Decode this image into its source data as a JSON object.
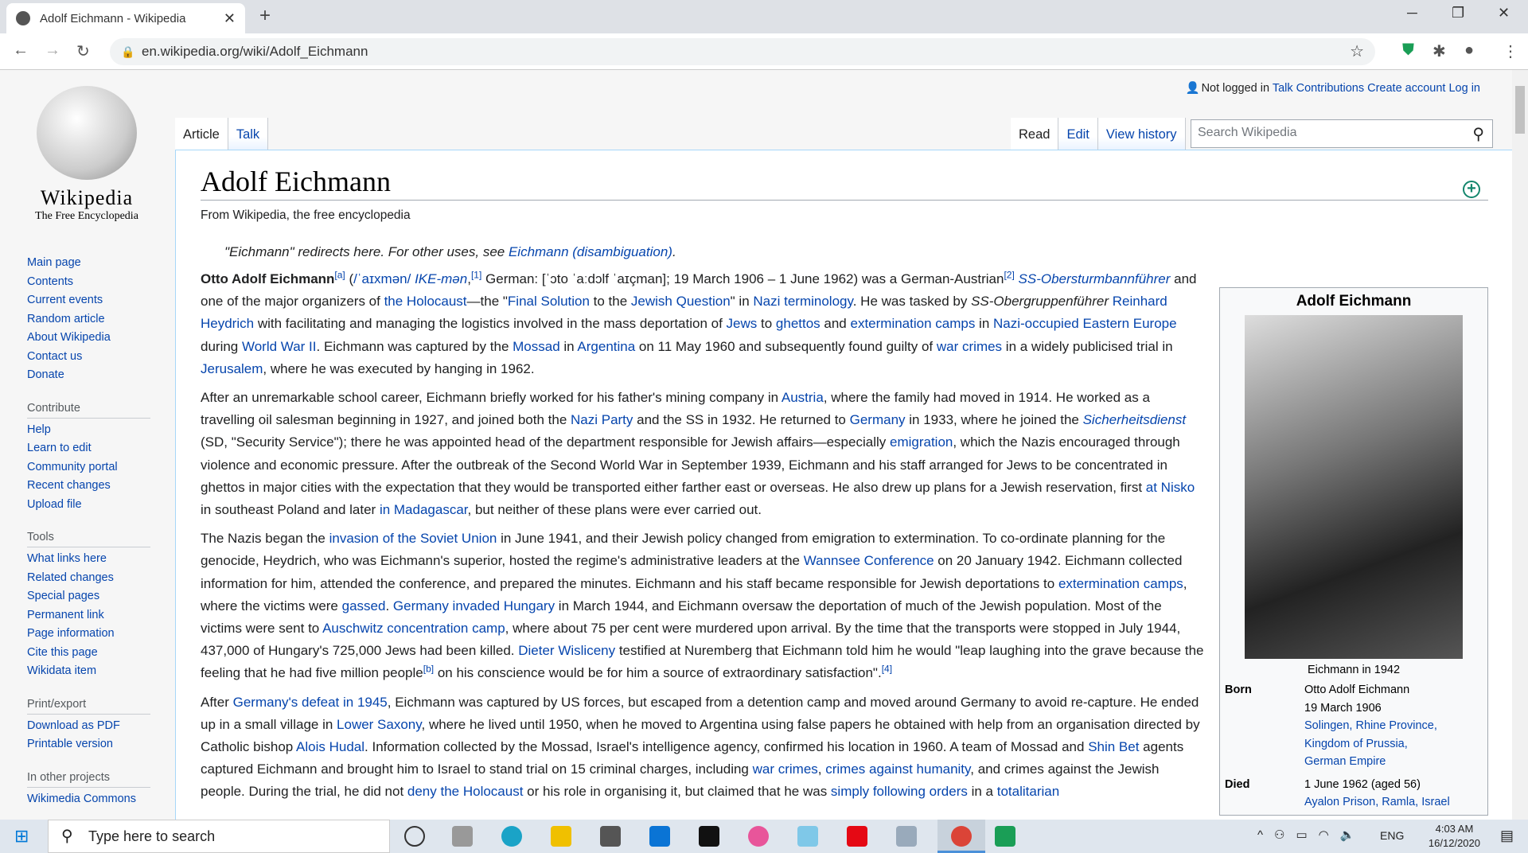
{
  "browser": {
    "tab_title": "Adolf Eichmann - Wikipedia",
    "url": "en.wikipedia.org/wiki/Adolf_Eichmann"
  },
  "logo": {
    "name": "Wikipedia",
    "tagline": "The Free Encyclopedia"
  },
  "sidebar": {
    "nav": [
      "Main page",
      "Contents",
      "Current events",
      "Random article",
      "About Wikipedia",
      "Contact us",
      "Donate"
    ],
    "contribute_heading": "Contribute",
    "contribute": [
      "Help",
      "Learn to edit",
      "Community portal",
      "Recent changes",
      "Upload file"
    ],
    "tools_heading": "Tools",
    "tools": [
      "What links here",
      "Related changes",
      "Special pages",
      "Permanent link",
      "Page information",
      "Cite this page",
      "Wikidata item"
    ],
    "print_heading": "Print/export",
    "print": [
      "Download as PDF",
      "Printable version"
    ],
    "projects_heading": "In other projects",
    "projects": [
      "Wikimedia Commons"
    ]
  },
  "personal": {
    "not_logged": "Not logged in",
    "talk": "Talk",
    "contributions": "Contributions",
    "create": "Create account",
    "login": "Log in"
  },
  "tabs": {
    "article": "Article",
    "talk": "Talk",
    "read": "Read",
    "edit": "Edit",
    "history": "View history"
  },
  "search": {
    "placeholder": "Search Wikipedia"
  },
  "article": {
    "title": "Adolf Eichmann",
    "subtitle": "From Wikipedia, the free encyclopedia",
    "hatnote": [
      {
        "t": "\"Eichmann\" redirects here. For other uses, see "
      },
      {
        "t": "Eichmann (disambiguation)",
        "l": 1
      },
      {
        "t": "."
      }
    ],
    "paragraphs": [
      [
        {
          "t": "Otto Adolf Eichmann",
          "b": 1
        },
        {
          "t": "[a]",
          "s": 1
        },
        {
          "t": " ("
        },
        {
          "t": "/ˈaɪxmən/",
          "l": 1
        },
        {
          "t": " "
        },
        {
          "t": "IKE-mən",
          "l": 1,
          "i": 1
        },
        {
          "t": ",",
          "}": 0
        },
        {
          "t": "[1]",
          "s": 1
        },
        {
          "t": " German: [ˈɔto ˈaːdɔlf ˈaɪçman]; 19 March 1906 – 1 June 1962) was a German-Austrian"
        },
        {
          "t": "[2]",
          "s": 1
        },
        {
          "t": " "
        },
        {
          "t": "SS-Obersturmbannführer",
          "l": 1,
          "i": 1
        },
        {
          "t": " and one of the major organizers of "
        },
        {
          "t": "the Holocaust",
          "l": 1
        },
        {
          "t": "—the \""
        },
        {
          "t": "Final Solution",
          "l": 1
        },
        {
          "t": " to the "
        },
        {
          "t": "Jewish Question",
          "l": 1
        },
        {
          "t": "\" in "
        },
        {
          "t": "Nazi terminology",
          "l": 1
        },
        {
          "t": ". He was tasked by "
        },
        {
          "t": "SS-Obergruppenführer",
          "i": 1
        },
        {
          "t": " "
        },
        {
          "t": "Reinhard Heydrich",
          "l": 1
        },
        {
          "t": " with facilitating and managing the logistics involved in the mass deportation of "
        },
        {
          "t": "Jews",
          "l": 1
        },
        {
          "t": " to "
        },
        {
          "t": "ghettos",
          "l": 1
        },
        {
          "t": " and "
        },
        {
          "t": "extermination camps",
          "l": 1
        },
        {
          "t": " in "
        },
        {
          "t": "Nazi-occupied Eastern Europe",
          "l": 1
        },
        {
          "t": " during "
        },
        {
          "t": "World War II",
          "l": 1
        },
        {
          "t": ". Eichmann was captured by the "
        },
        {
          "t": "Mossad",
          "l": 1
        },
        {
          "t": " in "
        },
        {
          "t": "Argentina",
          "l": 1
        },
        {
          "t": " on 11 May 1960 and subsequently found guilty of "
        },
        {
          "t": "war crimes",
          "l": 1
        },
        {
          "t": " in a widely publicised trial in "
        },
        {
          "t": "Jerusalem",
          "l": 1
        },
        {
          "t": ", where he was executed by hanging in 1962."
        }
      ],
      [
        {
          "t": "After an unremarkable school career, Eichmann briefly worked for his father's mining company in "
        },
        {
          "t": "Austria",
          "l": 1
        },
        {
          "t": ", where the family had moved in 1914. He worked as a travelling oil salesman beginning in 1927, and joined both the "
        },
        {
          "t": "Nazi Party",
          "l": 1
        },
        {
          "t": " and the SS in 1932. He returned to "
        },
        {
          "t": "Germany",
          "l": 1
        },
        {
          "t": " in 1933, where he joined the "
        },
        {
          "t": "Sicherheitsdienst",
          "l": 1,
          "i": 1
        },
        {
          "t": " (SD, \"Security Service\"); there he was appointed head of the department responsible for Jewish affairs—especially "
        },
        {
          "t": "emigration",
          "l": 1
        },
        {
          "t": ", which the Nazis encouraged through violence and economic pressure. After the outbreak of the Second World War in September 1939, Eichmann and his staff arranged for Jews to be concentrated in ghettos in major cities with the expectation that they would be transported either farther east or overseas. He also drew up plans for a Jewish reservation, first "
        },
        {
          "t": "at Nisko",
          "l": 1
        },
        {
          "t": " in southeast Poland and later "
        },
        {
          "t": "in Madagascar",
          "l": 1
        },
        {
          "t": ", but neither of these plans were ever carried out."
        }
      ],
      [
        {
          "t": "The Nazis began the "
        },
        {
          "t": "invasion of the Soviet Union",
          "l": 1
        },
        {
          "t": " in June 1941, and their Jewish policy changed from emigration to extermination. To co-ordinate planning for the genocide, Heydrich, who was Eichmann's superior, hosted the regime's administrative leaders at the "
        },
        {
          "t": "Wannsee Conference",
          "l": 1
        },
        {
          "t": " on 20 January 1942. Eichmann collected information for him, attended the conference, and prepared the minutes. Eichmann and his staff became responsible for Jewish deportations to "
        },
        {
          "t": "extermination camps",
          "l": 1
        },
        {
          "t": ", where the victims were "
        },
        {
          "t": "gassed",
          "l": 1
        },
        {
          "t": ". "
        },
        {
          "t": "Germany invaded Hungary",
          "l": 1
        },
        {
          "t": " in March 1944, and Eichmann oversaw the deportation of much of the Jewish population. Most of the victims were sent to "
        },
        {
          "t": "Auschwitz concentration camp",
          "l": 1
        },
        {
          "t": ", where about 75 per cent were murdered upon arrival. By the time that the transports were stopped in July 1944, 437,000 of Hungary's 725,000 Jews had been killed. "
        },
        {
          "t": "Dieter Wisliceny",
          "l": 1
        },
        {
          "t": " testified at Nuremberg that Eichmann told him he would \"leap laughing into the grave because the feeling that he had five million people"
        },
        {
          "t": "[b]",
          "s": 1
        },
        {
          "t": " on his conscience would be for him a source of extraordinary satisfaction\"."
        },
        {
          "t": "[4]",
          "s": 1
        }
      ],
      [
        {
          "t": "After "
        },
        {
          "t": "Germany's defeat in 1945",
          "l": 1
        },
        {
          "t": ", Eichmann was captured by US forces, but escaped from a detention camp and moved around Germany to avoid re-capture. He ended up in a small village in "
        },
        {
          "t": "Lower Saxony",
          "l": 1
        },
        {
          "t": ", where he lived until 1950, when he moved to Argentina using false papers he obtained with help from an organisation directed by Catholic bishop "
        },
        {
          "t": "Alois Hudal",
          "l": 1
        },
        {
          "t": ". Information collected by the Mossad, Israel's intelligence agency, confirmed his location in 1960. A team of Mossad and "
        },
        {
          "t": "Shin Bet",
          "l": 1
        },
        {
          "t": " agents captured Eichmann and brought him to Israel to stand trial on 15 criminal charges, including "
        },
        {
          "t": "war crimes",
          "l": 1
        },
        {
          "t": ", "
        },
        {
          "t": "crimes against humanity",
          "l": 1
        },
        {
          "t": ", and crimes against the Jewish people. During the trial, he did not "
        },
        {
          "t": "deny the Holocaust",
          "l": 1
        },
        {
          "t": " or his role in organising it, but claimed that he was "
        },
        {
          "t": "simply following orders",
          "l": 1
        },
        {
          "t": " in a "
        },
        {
          "t": "totalitarian",
          "l": 1
        }
      ]
    ]
  },
  "infobox": {
    "title": "Adolf Eichmann",
    "caption": "Eichmann in 1942",
    "born_label": "Born",
    "born": [
      "Otto Adolf Eichmann",
      "19 March 1906"
    ],
    "born_links": [
      "Solingen, Rhine Province,",
      "Kingdom of Prussia,",
      "German Empire"
    ],
    "died_label": "Died",
    "died": "1 June 1962 (aged 56)",
    "died_link": "Ayalon Prison, Ramla, Israel"
  },
  "taskbar": {
    "search_placeholder": "Type here to search",
    "lang": "ENG",
    "time": "4:03 AM",
    "date": "16/12/2020"
  }
}
